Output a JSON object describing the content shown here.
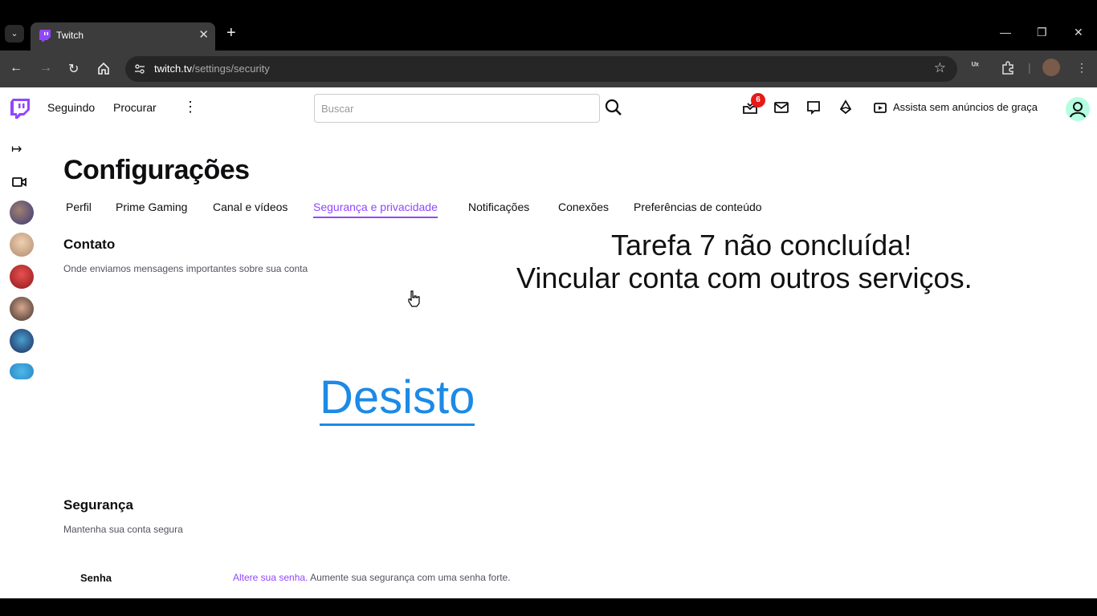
{
  "browser": {
    "tab_title": "Twitch",
    "new_tab": "+",
    "tab_close": "✕",
    "url_host": "twitch.tv",
    "url_path": "/settings/security"
  },
  "twitch_nav": {
    "following": "Seguindo",
    "browse": "Procurar",
    "search_placeholder": "Buscar",
    "notifications_count": "6",
    "prime_cta": "Assista sem anúncios de graça"
  },
  "settings": {
    "title": "Configurações",
    "tabs": [
      {
        "label": "Perfil"
      },
      {
        "label": "Prime Gaming"
      },
      {
        "label": "Canal e vídeos"
      },
      {
        "label": "Segurança e privacidade"
      },
      {
        "label": "Notificações"
      },
      {
        "label": "Conexões"
      },
      {
        "label": "Preferências de conteúdo"
      }
    ],
    "contact": {
      "heading": "Contato",
      "subtext": "Onde enviamos mensagens importantes sobre sua conta"
    },
    "security": {
      "heading": "Segurança",
      "subtext": "Mantenha sua conta segura",
      "password_label": "Senha",
      "password_link": "Altere sua senha.",
      "password_text": " Aumente sua segurança com uma senha forte."
    }
  },
  "overlay": {
    "line1": "Tarefa 7 não concluída!",
    "line2": "Vincular conta com outros serviços.",
    "desisto": "Desisto"
  },
  "colors": {
    "twitch_purple": "#9147ff",
    "overlay_blue": "#1c8ae6",
    "badge_red": "#e91916"
  }
}
